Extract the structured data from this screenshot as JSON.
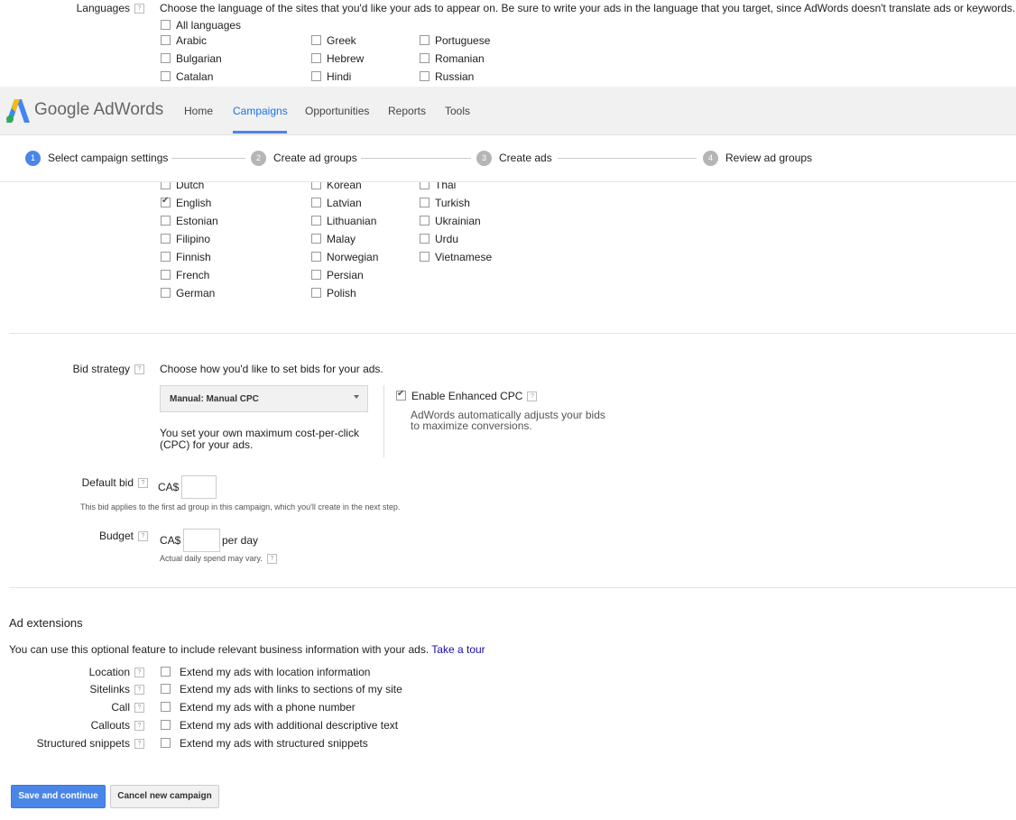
{
  "languages": {
    "label": "Languages",
    "description": "Choose the language of the sites that you'd like your ads to appear on. Be sure to write your ads in the language that you target, since AdWords doesn't translate ads or keywords.",
    "all": "All languages",
    "top_col1": [
      "Arabic",
      "Bulgarian",
      "Catalan"
    ],
    "top_col2": [
      "Greek",
      "Hebrew",
      "Hindi"
    ],
    "top_col3": [
      "Portuguese",
      "Romanian",
      "Russian"
    ],
    "lower_col1": [
      "Dutch",
      "English",
      "Estonian",
      "Filipino",
      "Finnish",
      "French",
      "German"
    ],
    "lower_col2": [
      "Korean",
      "Latvian",
      "Lithuanian",
      "Malay",
      "Norwegian",
      "Persian",
      "Polish"
    ],
    "lower_col3": [
      "Thai",
      "Turkish",
      "Ukrainian",
      "Urdu",
      "Vietnamese"
    ],
    "checked": "English"
  },
  "header": {
    "logo_text": "Google AdWords",
    "nav": [
      "Home",
      "Campaigns",
      "Opportunities",
      "Reports",
      "Tools"
    ],
    "active": "Campaigns"
  },
  "steps": [
    {
      "num": "1",
      "label": "Select campaign settings"
    },
    {
      "num": "2",
      "label": "Create ad groups"
    },
    {
      "num": "3",
      "label": "Create ads"
    },
    {
      "num": "4",
      "label": "Review ad groups"
    }
  ],
  "bid": {
    "label": "Bid strategy",
    "description": "Choose how you'd like to set bids for your ads.",
    "select_value": "Manual: Manual CPC",
    "select_note_1": "You set your own maximum cost-per-click",
    "select_note_2": "(CPC) for your ads.",
    "enhanced_label": "Enable Enhanced CPC",
    "enhanced_note_1": "AdWords automatically adjusts your bids",
    "enhanced_note_2": "to maximize conversions.",
    "enhanced_checked": true
  },
  "default_bid": {
    "label": "Default bid",
    "currency": "CA$",
    "note": "This bid applies to the first ad group in this campaign, which you'll create in the next step."
  },
  "budget": {
    "label": "Budget",
    "currency": "CA$",
    "suffix": "per day",
    "note": "Actual daily spend may vary."
  },
  "ad_extensions": {
    "title": "Ad extensions",
    "description": "You can use this optional feature to include relevant business information with your ads.",
    "tour_link": "Take a tour",
    "items": [
      {
        "label": "Location",
        "text": "Extend my ads with location information"
      },
      {
        "label": "Sitelinks",
        "text": "Extend my ads with links to sections of my site"
      },
      {
        "label": "Call",
        "text": "Extend my ads with a phone number"
      },
      {
        "label": "Callouts",
        "text": "Extend my ads with additional descriptive text"
      },
      {
        "label": "Structured snippets",
        "text": "Extend my ads with structured snippets"
      }
    ]
  },
  "buttons": {
    "save": "Save and continue",
    "cancel": "Cancel new campaign"
  },
  "colors": {
    "accent": "#4a86e8",
    "link": "#1a0dab",
    "step_inactive": "#b5b5b5"
  }
}
